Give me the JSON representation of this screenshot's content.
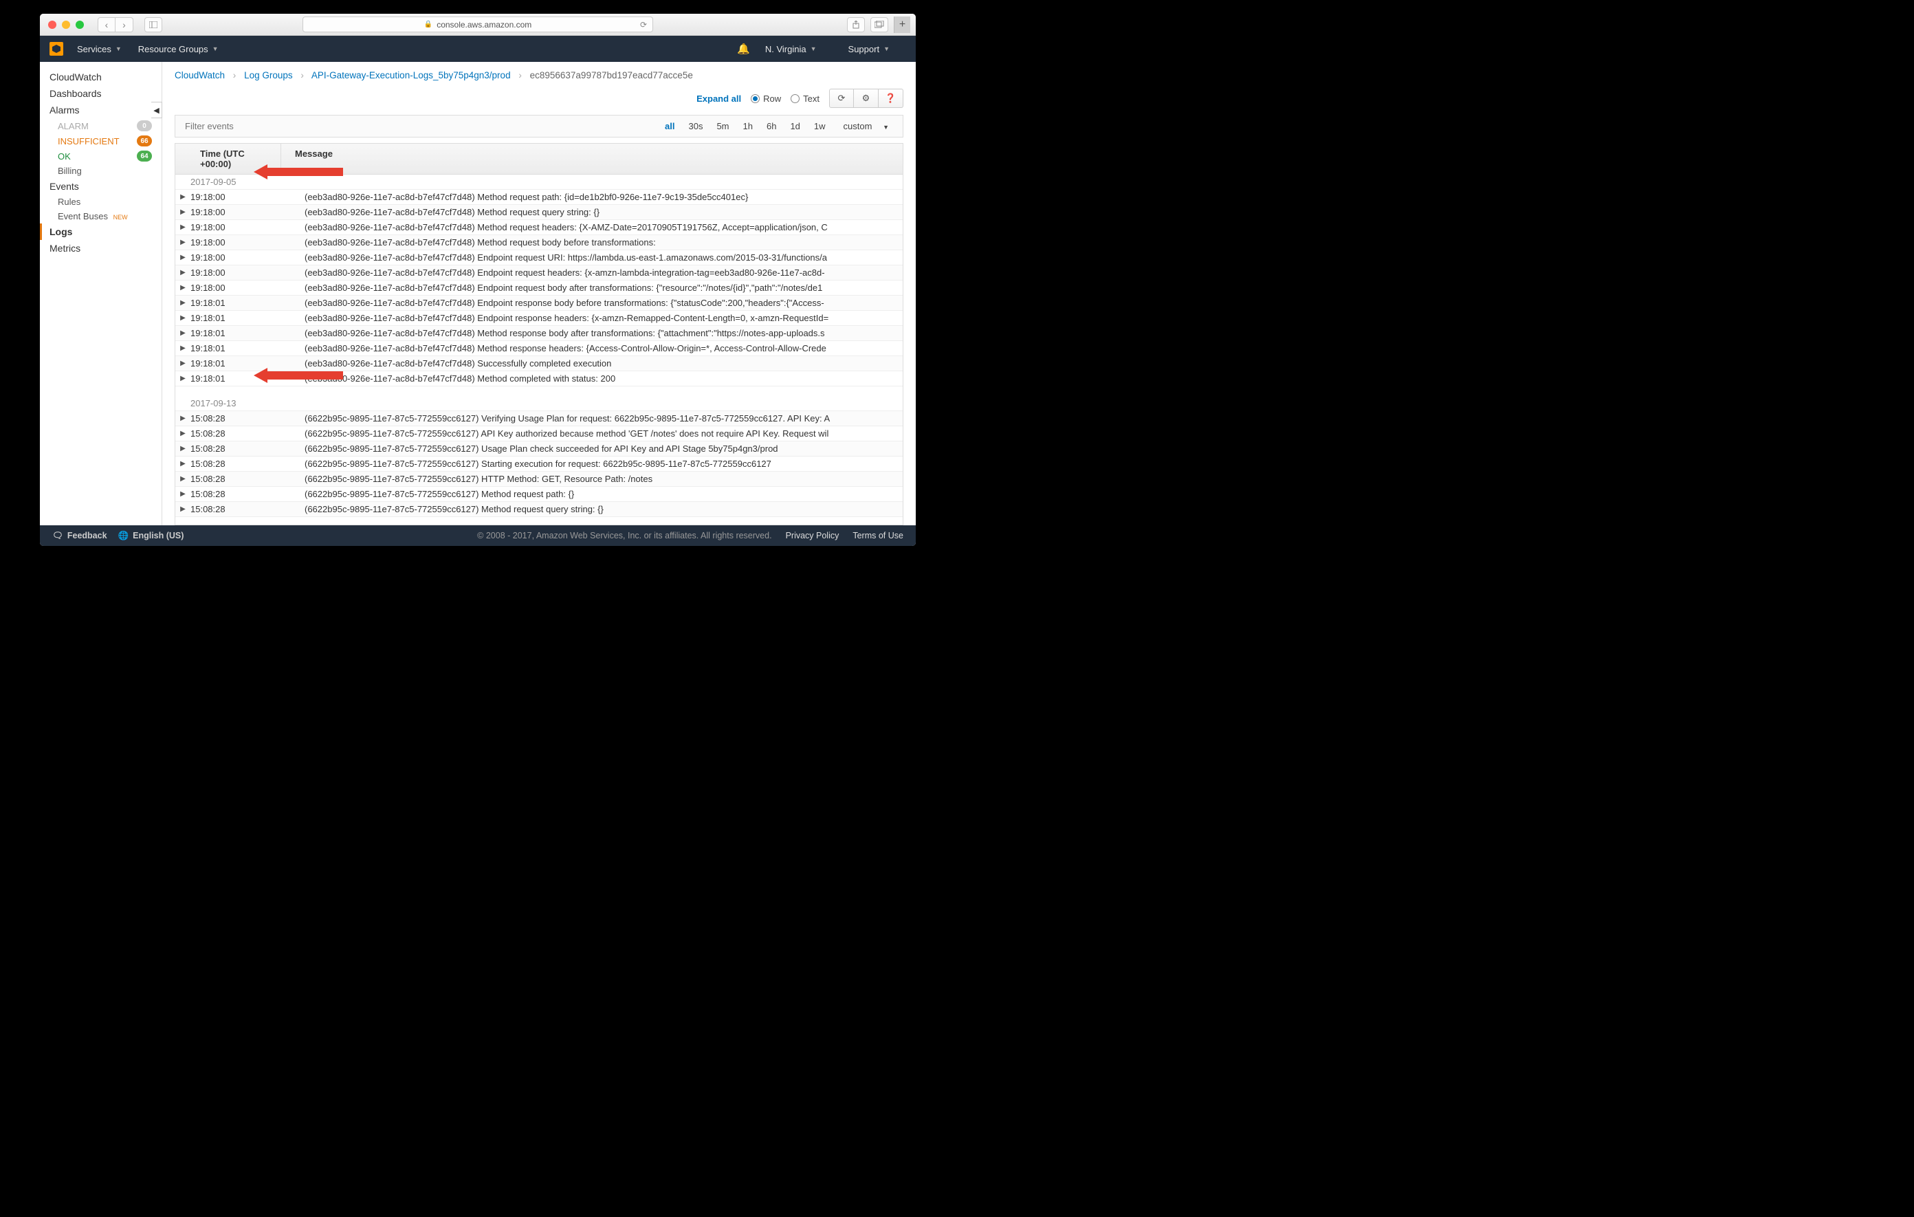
{
  "browser": {
    "url": "console.aws.amazon.com"
  },
  "aws_header": {
    "services": "Services",
    "resource_groups": "Resource Groups",
    "region": "N. Virginia",
    "support": "Support"
  },
  "sidebar": {
    "cloudwatch": "CloudWatch",
    "dashboards": "Dashboards",
    "alarms": "Alarms",
    "alarm": "ALARM",
    "alarm_count": "0",
    "insufficient": "INSUFFICIENT",
    "insufficient_count": "66",
    "ok": "OK",
    "ok_count": "64",
    "billing": "Billing",
    "events": "Events",
    "rules": "Rules",
    "event_buses": "Event Buses",
    "new_tag": "NEW",
    "logs": "Logs",
    "metrics": "Metrics"
  },
  "breadcrumb": {
    "cloudwatch": "CloudWatch",
    "log_groups": "Log Groups",
    "group": "API-Gateway-Execution-Logs_5by75p4gn3/prod",
    "stream": "ec8956637a99787bd197eacd77acce5e"
  },
  "controls": {
    "expand_all": "Expand all",
    "row": "Row",
    "text": "Text"
  },
  "filter": {
    "placeholder": "Filter events",
    "ranges": {
      "all": "all",
      "r30s": "30s",
      "r5m": "5m",
      "r1h": "1h",
      "r6h": "6h",
      "r1d": "1d",
      "r1w": "1w",
      "custom": "custom"
    }
  },
  "log_header": {
    "time": "Time (UTC +00:00)",
    "message": "Message"
  },
  "dates": {
    "d1": "2017-09-05",
    "d2": "2017-09-13"
  },
  "rows1": [
    {
      "t": "19:18:00",
      "m": "(eeb3ad80-926e-11e7-ac8d-b7ef47cf7d48) Method request path: {id=de1b2bf0-926e-11e7-9c19-35de5cc401ec}"
    },
    {
      "t": "19:18:00",
      "m": "(eeb3ad80-926e-11e7-ac8d-b7ef47cf7d48) Method request query string: {}"
    },
    {
      "t": "19:18:00",
      "m": "(eeb3ad80-926e-11e7-ac8d-b7ef47cf7d48) Method request headers: {X-AMZ-Date=20170905T191756Z, Accept=application/json, C"
    },
    {
      "t": "19:18:00",
      "m": "(eeb3ad80-926e-11e7-ac8d-b7ef47cf7d48) Method request body before transformations:"
    },
    {
      "t": "19:18:00",
      "m": "(eeb3ad80-926e-11e7-ac8d-b7ef47cf7d48) Endpoint request URI: https://lambda.us-east-1.amazonaws.com/2015-03-31/functions/a"
    },
    {
      "t": "19:18:00",
      "m": "(eeb3ad80-926e-11e7-ac8d-b7ef47cf7d48) Endpoint request headers: {x-amzn-lambda-integration-tag=eeb3ad80-926e-11e7-ac8d-"
    },
    {
      "t": "19:18:00",
      "m": "(eeb3ad80-926e-11e7-ac8d-b7ef47cf7d48) Endpoint request body after transformations: {\"resource\":\"/notes/{id}\",\"path\":\"/notes/de1"
    },
    {
      "t": "19:18:01",
      "m": "(eeb3ad80-926e-11e7-ac8d-b7ef47cf7d48) Endpoint response body before transformations: {\"statusCode\":200,\"headers\":{\"Access-"
    },
    {
      "t": "19:18:01",
      "m": "(eeb3ad80-926e-11e7-ac8d-b7ef47cf7d48) Endpoint response headers: {x-amzn-Remapped-Content-Length=0, x-amzn-RequestId="
    },
    {
      "t": "19:18:01",
      "m": "(eeb3ad80-926e-11e7-ac8d-b7ef47cf7d48) Method response body after transformations: {\"attachment\":\"https://notes-app-uploads.s"
    },
    {
      "t": "19:18:01",
      "m": "(eeb3ad80-926e-11e7-ac8d-b7ef47cf7d48) Method response headers: {Access-Control-Allow-Origin=*, Access-Control-Allow-Crede"
    },
    {
      "t": "19:18:01",
      "m": "(eeb3ad80-926e-11e7-ac8d-b7ef47cf7d48) Successfully completed execution"
    },
    {
      "t": "19:18:01",
      "m": "(eeb3ad80-926e-11e7-ac8d-b7ef47cf7d48) Method completed with status: 200"
    }
  ],
  "rows2": [
    {
      "t": "15:08:28",
      "m": "(6622b95c-9895-11e7-87c5-772559cc6127) Verifying Usage Plan for request: 6622b95c-9895-11e7-87c5-772559cc6127. API Key: A"
    },
    {
      "t": "15:08:28",
      "m": "(6622b95c-9895-11e7-87c5-772559cc6127) API Key authorized because method 'GET /notes' does not require API Key. Request wil"
    },
    {
      "t": "15:08:28",
      "m": "(6622b95c-9895-11e7-87c5-772559cc6127) Usage Plan check succeeded for API Key and API Stage 5by75p4gn3/prod"
    },
    {
      "t": "15:08:28",
      "m": "(6622b95c-9895-11e7-87c5-772559cc6127) Starting execution for request: 6622b95c-9895-11e7-87c5-772559cc6127"
    },
    {
      "t": "15:08:28",
      "m": "(6622b95c-9895-11e7-87c5-772559cc6127) HTTP Method: GET, Resource Path: /notes"
    },
    {
      "t": "15:08:28",
      "m": "(6622b95c-9895-11e7-87c5-772559cc6127) Method request path: {}"
    },
    {
      "t": "15:08:28",
      "m": "(6622b95c-9895-11e7-87c5-772559cc6127) Method request query string: {}"
    }
  ],
  "footer": {
    "feedback": "Feedback",
    "language": "English (US)",
    "copyright": "© 2008 - 2017, Amazon Web Services, Inc. or its affiliates. All rights reserved.",
    "privacy": "Privacy Policy",
    "terms": "Terms of Use"
  }
}
